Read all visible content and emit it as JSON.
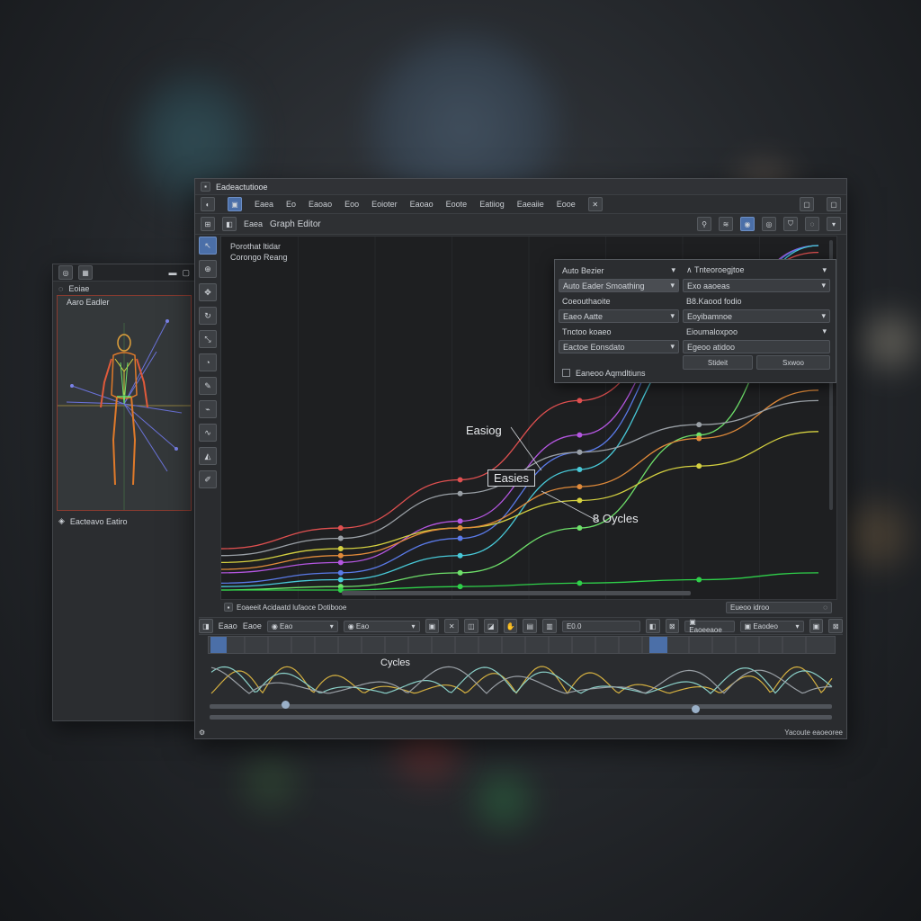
{
  "viewport_window": {
    "header_left": "Eoiae",
    "header_label": "Aaro Eadler",
    "footer_label": "Eacteavo Eatiro"
  },
  "main_window": {
    "title": "Eadeactutiooe",
    "menu": [
      "Eaea",
      "Eo",
      "Eaoao",
      "Eoo",
      "Eoioter",
      "Eaoao",
      "Eoote",
      "Eatiiog",
      "Eaeaiie",
      "Eooe"
    ],
    "editor": {
      "prefix": "Eaea",
      "title": "Graph Editor"
    },
    "graph": {
      "label_line1": "Porothat ltidar",
      "label_line2": "Corongo Reang",
      "annotations": {
        "easing": "Easiog",
        "easies": "Easies",
        "cycles": "8 Oycles"
      }
    },
    "popover": {
      "left_fields": [
        "Auto Bezier",
        "Auto Eader Smoathing",
        "Coeouthaoite",
        "Eaeo Aatte",
        "Tnctoo koaeo",
        "Eactoe Eonsdato"
      ],
      "right_fields": [
        "Tnteoroegjtoe",
        "Exo aaoeas",
        "B8.Kaood fodio",
        "Eoyibamnoe",
        "Eioumaloxpoo",
        "Egeoo atidoo"
      ],
      "buttons": [
        "Stideit",
        "Sxwoo"
      ],
      "checkbox_label": "Eaneoo Aqmdltiuns"
    },
    "status_left": "Eoaeeit Acidaatd lufaoce Dotibooe",
    "status_right": "Eueoo idroo",
    "dopesheet": {
      "labels": [
        "Eaao",
        "Eaoe",
        "Eao",
        "Eao",
        "Eaoeeaoe",
        "Eaodeo"
      ],
      "value": "E0.0",
      "cycles": "Cycles"
    },
    "bottom_status": "Yacoute eaoeoree"
  },
  "chart_data": {
    "type": "line",
    "title": "",
    "xlabel": "",
    "ylabel": "",
    "series": [
      {
        "color": "#e05050",
        "values": [
          0.12,
          0.18,
          0.32,
          0.55,
          0.8,
          0.98
        ]
      },
      {
        "color": "#b456e0",
        "values": [
          0.05,
          0.08,
          0.2,
          0.45,
          0.8,
          1.0
        ]
      },
      {
        "color": "#5a7ae8",
        "values": [
          0.02,
          0.05,
          0.15,
          0.4,
          0.78,
          1.0
        ]
      },
      {
        "color": "#48c9d8",
        "values": [
          0.01,
          0.03,
          0.1,
          0.35,
          0.72,
          1.0
        ]
      },
      {
        "color": "#6ee06a",
        "values": [
          0.0,
          0.01,
          0.05,
          0.18,
          0.45,
          0.9
        ]
      },
      {
        "color": "#d4d040",
        "values": [
          0.08,
          0.12,
          0.18,
          0.26,
          0.36,
          0.46
        ]
      },
      {
        "color": "#e08a3a",
        "values": [
          0.06,
          0.1,
          0.18,
          0.3,
          0.44,
          0.58
        ]
      },
      {
        "color": "#9aa0a6",
        "values": [
          0.1,
          0.15,
          0.28,
          0.4,
          0.48,
          0.55
        ]
      },
      {
        "color": "#2fd04a",
        "values": [
          0.0,
          0.0,
          0.01,
          0.02,
          0.03,
          0.05
        ]
      }
    ]
  }
}
